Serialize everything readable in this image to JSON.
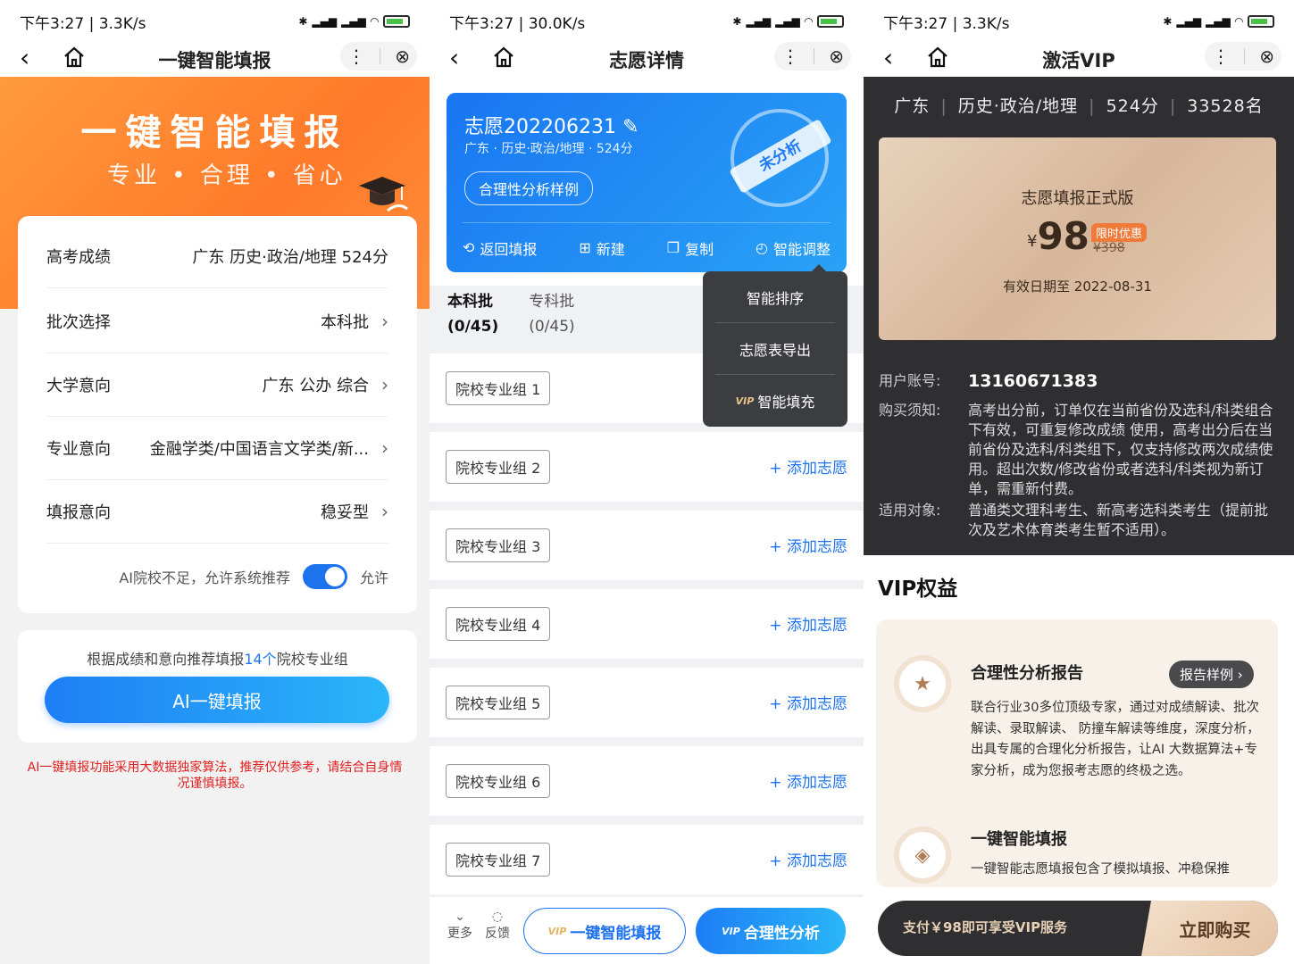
{
  "status": {
    "p1": {
      "time": "下午3:27 | 3.3K/s"
    },
    "p2": {
      "time": "下午3:27 | 30.0K/s"
    },
    "p3": {
      "time": "下午3:27 | 3.3K/s"
    }
  },
  "p1": {
    "nav_title": "一键智能填报",
    "banner_title": "一键智能填报",
    "banner_sub": "专业 • 合理 • 省心",
    "rows": [
      {
        "label": "高考成绩",
        "value": "广东 历史·政治/地理 524分"
      },
      {
        "label": "批次选择",
        "value": "本科批"
      },
      {
        "label": "大学意向",
        "value": "广东 公办 综合"
      },
      {
        "label": "专业意向",
        "value": "金融学类/中国语言文学类/新..."
      },
      {
        "label": "填报意向",
        "value": "稳妥型"
      }
    ],
    "toggle_text": "AI院校不足，允许系统推荐",
    "toggle_label": "允许",
    "rec_prefix": "根据成绩和意向推荐填报",
    "rec_count": "14个",
    "rec_suffix": "院校专业组",
    "ai_button": "AI一键填报",
    "warning": "AI一键填报功能采用大数据独家算法，推荐仅供参考，请结合自身情况谨慎填报。"
  },
  "p2": {
    "nav_title": "志愿详情",
    "plan_name": "志愿202206231",
    "plan_info": "广东 ·  历史·政治/地理 ·  524分",
    "analyze_sample": "合理性分析样例",
    "stamp": "未分析",
    "actions": [
      "返回填报",
      "新建",
      "复制",
      "智能调整"
    ],
    "tabs": [
      {
        "name": "本科批",
        "count": "(0/45)"
      },
      {
        "name": "专科批",
        "count": "(0/45)"
      }
    ],
    "groups": [
      "院校专业组 1",
      "院校专业组 2",
      "院校专业组 3",
      "院校专业组 4",
      "院校专业组 5",
      "院校专业组 6",
      "院校专业组 7"
    ],
    "add_label": "+ 添加志愿",
    "dropdown": [
      "智能排序",
      "志愿表导出",
      "智能填充"
    ],
    "vip_badge": "VIP",
    "bottom": {
      "more": "更多",
      "feedback": "反馈",
      "btn1": "一键智能填报",
      "btn2": "合理性分析"
    }
  },
  "p3": {
    "nav_title": "激活VIP",
    "top_info": [
      "广东",
      "历史·政治/地理",
      "524分",
      "33528名"
    ],
    "card_title": "志愿填报正式版",
    "currency": "¥",
    "price": "98",
    "limited": "限时优惠",
    "old_price": "¥398",
    "valid": "有效日期至 2022-08-31",
    "account_label": "用户账号:",
    "account": "13160671383",
    "notice_label": "购买须知:",
    "notice": "高考出分前，订单仅在当前省份及选科/科类组合下有效，可重复修改成绩 使用，高考出分后在当前省份及选科/科类组下，仅支持修改两次成绩使用。超出次数/修改省份或者选科/科类视为新订单，需重新付费。",
    "target_label": "适用对象:",
    "target": "普通类文理科考生、新高考选科类考生（提前批次及艺术体育类考生暂不适用）。",
    "vip_heading": "VIP权益",
    "benefit1_title": "合理性分析报告",
    "benefit1_sample": "报告样例 ›",
    "benefit1_desc": "联合行业30多位顶级专家，通过对成绩解读、批次解读、录取解读、 防撞车解读等维度，深度分析，出具专属的合理化分析报告，让AI 大数据算法+专家分析，成为您报考志愿的终极之选。",
    "benefit2_title": "一键智能填报",
    "benefit2_desc": "一键智能志愿填报包含了模拟填报、冲稳保推",
    "pay_text": "支付￥98即可享受VIP服务",
    "buy_button": "立即购买"
  }
}
